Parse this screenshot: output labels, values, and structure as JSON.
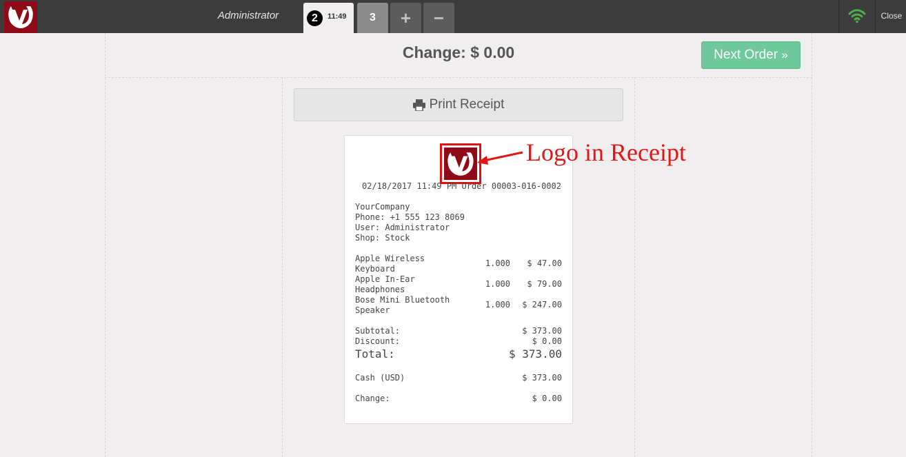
{
  "topbar": {
    "username": "Administrator",
    "active_order": {
      "seq": "2",
      "time": "11:49"
    },
    "other_order": "3",
    "add_label": "+",
    "remove_label": "−",
    "close_label": "Close"
  },
  "header": {
    "change_title": "Change: $ 0.00",
    "next_order_label": "Next Order"
  },
  "print_receipt_label": "Print Receipt",
  "receipt": {
    "header_line": "02/18/2017 11:49 PM Order 00003-016-0002",
    "company": "YourCompany",
    "phone": "Phone: +1 555 123 8069",
    "user": "User: Administrator",
    "shop": "Shop: Stock",
    "lines": [
      {
        "name1": "Apple Wireless",
        "name2": "Keyboard",
        "qty": "1.000",
        "price": "$ 47.00"
      },
      {
        "name1": "Apple In-Ear",
        "name2": "Headphones",
        "qty": "1.000",
        "price": "$ 79.00"
      },
      {
        "name1": "Bose Mini Bluetooth",
        "name2": "Speaker",
        "qty": "1.000",
        "price": "$ 247.00"
      }
    ],
    "subtotal_label": "Subtotal:",
    "subtotal_value": "$ 373.00",
    "discount_label": "Discount:",
    "discount_value": "$ 0.00",
    "total_label": "Total:",
    "total_value": "$ 373.00",
    "cash_label": "Cash (USD)",
    "cash_value": "$ 373.00",
    "change_label": "Change:",
    "change_value": "$ 0.00"
  },
  "annotation": "Logo in Receipt",
  "colors": {
    "brand": "#8f0a16",
    "accent_green": "#6ec89b",
    "annotation_red": "#e51515",
    "topbar": "#3c3c3c",
    "wifi": "#4caf50"
  },
  "icons": {
    "logo": "v-logo-icon",
    "print": "printer-icon",
    "next": "double-chevron-right-icon",
    "wifi": "wifi-icon"
  }
}
